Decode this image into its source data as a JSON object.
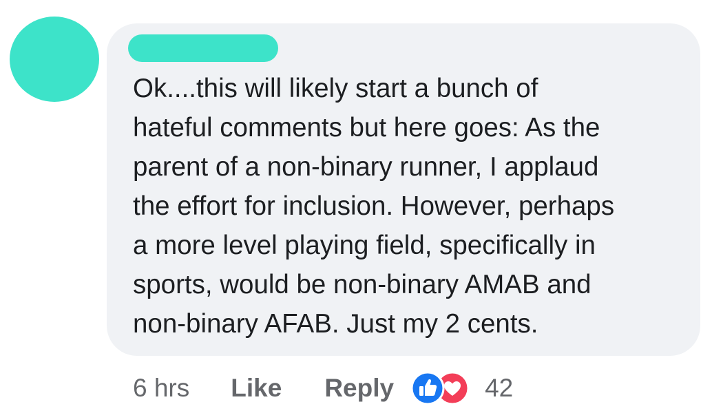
{
  "comment": {
    "text": "Ok....this will likely start a bunch of\nhateful comments but here goes:  As the\nparent of a non-binary runner, I applaud\nthe effort for inclusion. However, perhaps\na more level playing field, specifically in\nsports, would be non-binary AMAB and\nnon-binary AFAB. Just my 2 cents.",
    "timestamp": "6 hrs",
    "like_label": "Like",
    "reply_label": "Reply",
    "reaction_count": "42",
    "reactions": [
      "like-icon",
      "love-icon"
    ]
  },
  "colors": {
    "redaction": "#3de3c9",
    "bubble": "#f0f2f5",
    "like_blue": "#1877f2",
    "love_red": "#f33e58",
    "meta_gray": "#65676b"
  }
}
